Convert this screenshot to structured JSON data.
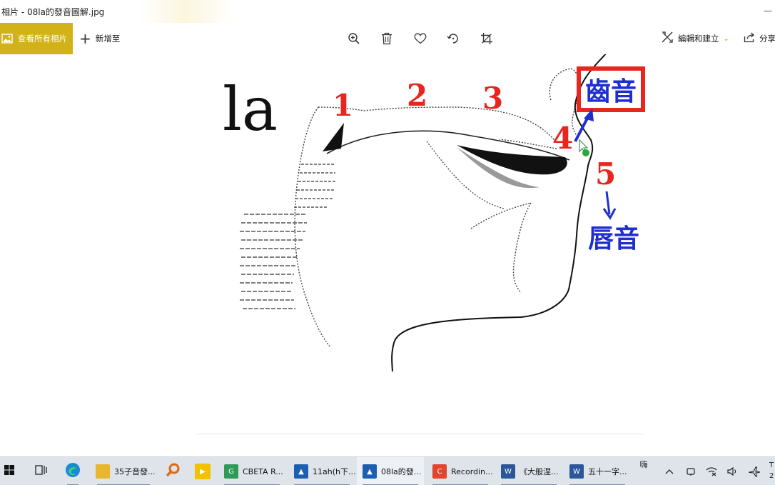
{
  "window": {
    "title": "相片 - 08la的發音圖解.jpg",
    "minimize_glyph": "—"
  },
  "toolbar": {
    "view_all_label": "查看所有相片",
    "view_all_icon": "picture-icon",
    "add_to_label": "新增至",
    "zoom_icon": "zoom-in-icon",
    "delete_icon": "trash-icon",
    "favorite_icon": "heart-icon",
    "rotate_icon": "rotate-icon",
    "crop_icon": "crop-icon",
    "edit_create_label": "編輯和建立",
    "share_label": "分享",
    "accent_color": "#d1b317"
  },
  "photo": {
    "syllable": "la",
    "markers": [
      "1",
      "2",
      "3",
      "4",
      "5"
    ],
    "marker_color": "#e8261f",
    "dental_label": "齒音",
    "labial_label": "唇音",
    "label_color": "#1f2fcf"
  },
  "taskbar": {
    "items": [
      {
        "label": "",
        "icon": "windows-start-icon"
      },
      {
        "label": "",
        "icon": "task-view-icon"
      },
      {
        "label": "",
        "icon": "edge-browser-icon"
      },
      {
        "label": "35子音發...",
        "icon": "folder-icon"
      },
      {
        "label": "",
        "icon": "search-magnifier-icon"
      },
      {
        "label": "",
        "icon": "player-icon"
      },
      {
        "label": "CBETA R...",
        "icon": "cbeta-icon"
      },
      {
        "label": "11ah(h下...",
        "icon": "photos-icon"
      },
      {
        "label": "08la的發...",
        "icon": "photos-icon"
      },
      {
        "label": "Recordin...",
        "icon": "recorder-icon"
      },
      {
        "label": "《大般涅...",
        "icon": "word-icon"
      },
      {
        "label": "五十一字...",
        "icon": "word-icon"
      }
    ],
    "ime_label": "嗨",
    "clock_glyph": "T",
    "clock_digit": "2"
  }
}
